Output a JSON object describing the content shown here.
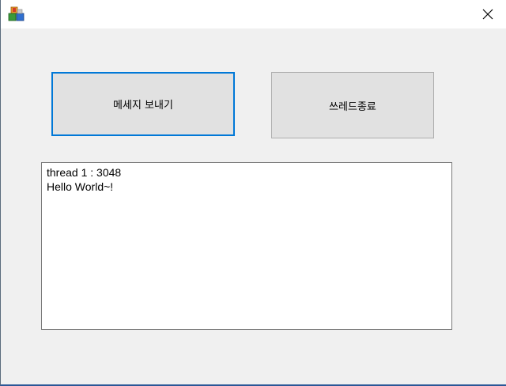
{
  "window": {
    "icon": "app-blocks-icon",
    "close_icon": "close-icon"
  },
  "buttons": {
    "send_label": "메세지 보내기",
    "stop_label": "쓰레드종료"
  },
  "output": {
    "lines": [
      "thread 1 : 3048",
      "Hello World~!"
    ]
  },
  "colors": {
    "focus_border": "#0078d7",
    "button_bg": "#e1e1e1",
    "client_bg": "#f0f0f0"
  }
}
